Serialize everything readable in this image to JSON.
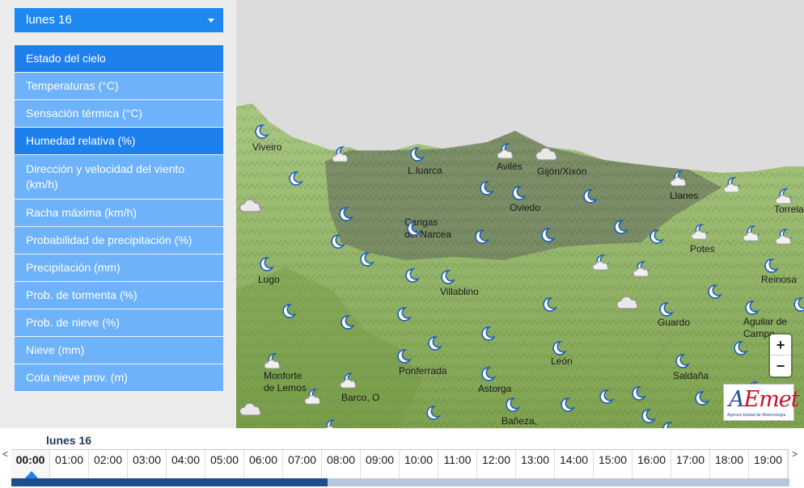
{
  "day_selector": {
    "label": "lunes 16"
  },
  "menu": [
    {
      "label": "Estado del cielo",
      "active": true
    },
    {
      "label": "Temperaturas (°C)",
      "active": false
    },
    {
      "label": "Sensación térmica (°C)",
      "active": false
    },
    {
      "label": "Humedad relativa (%)",
      "active": true
    },
    {
      "label": "Dirección y velocidad del viento (km/h)",
      "active": false
    },
    {
      "label": "Racha máxima (km/h)",
      "active": false
    },
    {
      "label": "Probabilidad de precipitación (%)",
      "active": false
    },
    {
      "label": "Precipitación (mm)",
      "active": false
    },
    {
      "label": "Prob. de tormenta (%)",
      "active": false
    },
    {
      "label": "Prob. de nieve (%)",
      "active": false
    },
    {
      "label": "Nieve (mm)",
      "active": false
    },
    {
      "label": "Cota nieve prov. (m)",
      "active": false
    }
  ],
  "cities": [
    "Viveiro",
    "L.luarca",
    "Avilés",
    "Gijón/Xixón",
    "Llanes",
    "Torrela",
    "Oviedo",
    "Cangas\ndel Narcea",
    "Potes",
    "Villablino",
    "Lugo",
    "Reinosa",
    "Guardo",
    "Aguilar de\nCampo",
    "León",
    "Ponferrada",
    "Monforte\nde Lemos",
    "Saldaña",
    "Barco, O",
    "Astorga",
    "Bañeza,"
  ],
  "zoom": {
    "in": "+",
    "out": "−"
  },
  "logo": {
    "name_a": "A",
    "name_rest": "Emet",
    "subtitle": "Agencia Estatal de Meteorología"
  },
  "timeline": {
    "day": "lunes 16",
    "prev": "<",
    "next": ">",
    "hours": [
      "00:00",
      "01:00",
      "02:00",
      "03:00",
      "04:00",
      "05:00",
      "06:00",
      "07:00",
      "08:00",
      "09:00",
      "10:00",
      "11:00",
      "12:00",
      "13:00",
      "14:00",
      "15:00",
      "16:00",
      "17:00",
      "18:00",
      "19:00"
    ],
    "selected_index": 0,
    "progress": 0.406
  },
  "colors": {
    "menu_active": "#1e80ec",
    "menu_inactive": "#6eb2fa",
    "moon": "#1b5fb8",
    "map_land": "#9bbf6a",
    "map_dark_region": "#7d8c70"
  },
  "icons": {
    "clear_night": "moon-icon",
    "partly_cloudy_night": "moon-cloud-icon",
    "cloudy": "cloud-icon"
  }
}
